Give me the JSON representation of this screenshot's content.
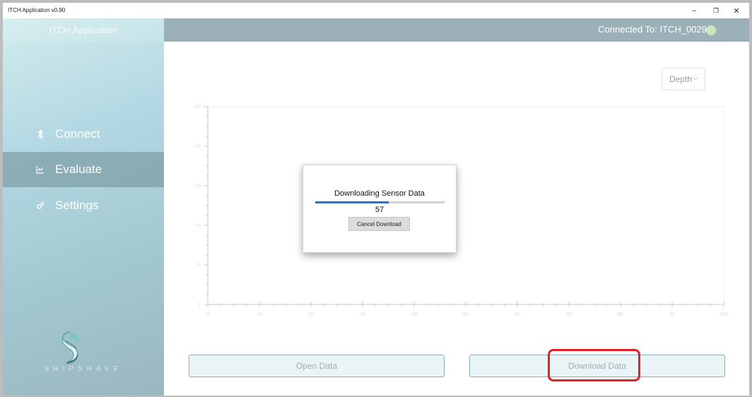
{
  "window": {
    "title": "ITCH Application v0.90",
    "controls": {
      "minimize": "–",
      "maximize": "❐",
      "close": "✕"
    }
  },
  "sidebar": {
    "app_title": "ITCH Application",
    "items": [
      {
        "label": "Connect",
        "icon": "bluetooth-icon",
        "active": false
      },
      {
        "label": "Evaluate",
        "icon": "chart-icon",
        "active": true
      },
      {
        "label": "Settings",
        "icon": "gear-icon",
        "active": false
      }
    ],
    "brand": "SHIPSHAVE"
  },
  "header": {
    "connection_text": "Connected To: ITCH_0029",
    "status_color": "#c8e8c3"
  },
  "main": {
    "dropdown": {
      "selected": "Depth"
    },
    "buttons": {
      "open": "Open Data",
      "download": "Download Data"
    }
  },
  "chart_data": {
    "type": "line",
    "title": "",
    "xlabel": "",
    "ylabel": "",
    "xlim": [
      0,
      100
    ],
    "ylim": [
      0,
      100
    ],
    "x_ticks": [
      "0",
      "10",
      "20",
      "30",
      "40",
      "50",
      "60",
      "70",
      "80",
      "90",
      "100"
    ],
    "y_ticks": [
      "0",
      "20",
      "40",
      "60",
      "80",
      "100"
    ],
    "series": []
  },
  "modal": {
    "title": "Downloading Sensor Data",
    "count": "57",
    "progress": 0.57,
    "cancel_label": "Cancel Download"
  },
  "colors": {
    "accent": "#1976d2",
    "highlight": "#e0212a",
    "header": "#9bb1b7"
  }
}
